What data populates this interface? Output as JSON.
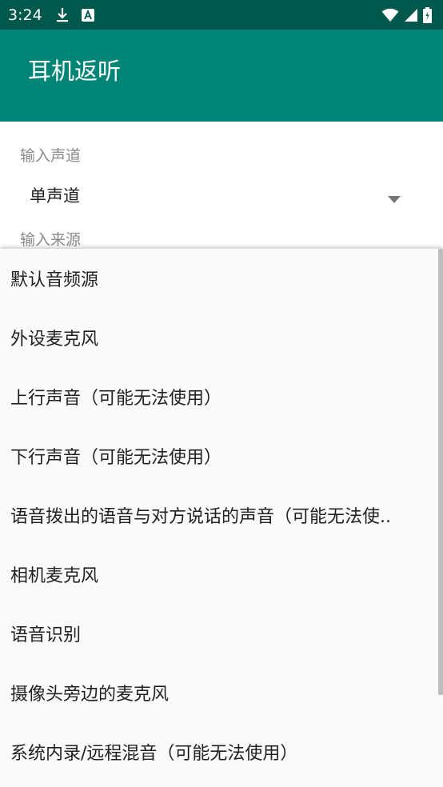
{
  "status_bar": {
    "time": "3:24",
    "left_icons": [
      "download-icon",
      "text-a-icon"
    ],
    "right_icons": [
      "wifi-icon",
      "signal-icon",
      "battery-icon"
    ],
    "color": "#00574b"
  },
  "app_bar": {
    "title": "耳机返听",
    "color": "#008577"
  },
  "form": {
    "channel_label": "输入声道",
    "channel_value": "单声道",
    "source_label": "输入来源"
  },
  "source_options": [
    "默认音频源",
    "外设麦克风",
    "上行声音（可能无法使用）",
    "下行声音（可能无法使用）",
    "语音拨出的语音与对方说话的声音（可能无法使..",
    "相机麦克风",
    "语音识别",
    "摄像头旁边的麦克风",
    "系统内录/远程混音（可能无法使用）"
  ]
}
